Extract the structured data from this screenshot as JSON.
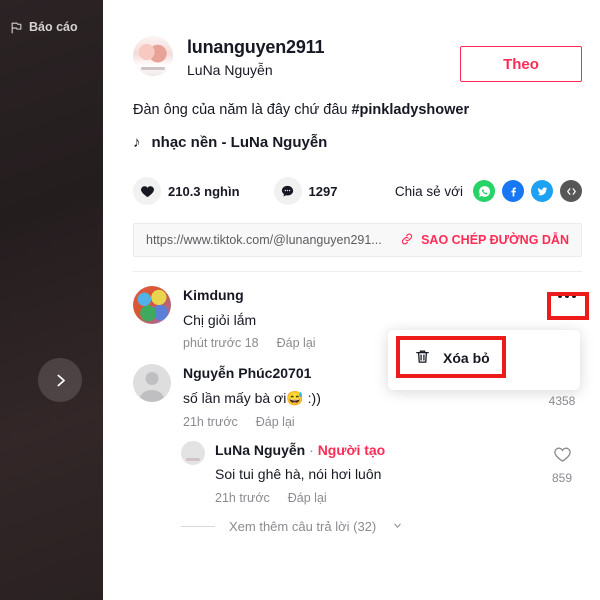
{
  "video_panel": {
    "report_label": "Báo cáo",
    "report_icon": "flag-icon",
    "next_icon": "chevron-right-icon"
  },
  "post": {
    "username": "lunanguyen2911",
    "nickname": "LuNa Nguyễn",
    "follow_label": "Theo",
    "caption_text": "Đàn ông của năm là đây chứ đâu ",
    "caption_hashtag": "#pinkladyshower",
    "music_icon": "music-note-icon",
    "music_title": "nhạc nền - LuNa Nguyễn",
    "avatar_icon": "author-avatar"
  },
  "engagement": {
    "like_icon": "heart-filled-icon",
    "like_count": "210.3 nghìn",
    "comment_icon": "comment-bubble-icon",
    "comment_count": "1297",
    "share_label": "Chia sẻ với",
    "share_targets": [
      {
        "name": "whatsapp-icon",
        "color": "#25D366"
      },
      {
        "name": "facebook-icon",
        "color": "#1877F2"
      },
      {
        "name": "twitter-icon",
        "color": "#1DA1F2"
      },
      {
        "name": "embed-code-icon",
        "color": "#575757"
      }
    ]
  },
  "link_bar": {
    "url": "https://www.tiktok.com/@lunanguyen291...",
    "placeholder": "https://www.tiktok.com/",
    "copy_icon": "link-icon",
    "copy_label_plain": "SAO CHÉP ",
    "copy_label_bold": "ĐƯỜNG DẪN"
  },
  "comments": [
    {
      "avatar": "kimdung-avatar",
      "name": "Kimdung",
      "text": "Chị giỏi lắm",
      "time": "phút trước 18",
      "reply_label": "Đáp lại",
      "has_more_menu": true
    },
    {
      "avatar": "default-avatar",
      "name": "Nguyễn Phúc20701",
      "text": "số lần mấy bà ơi😅 :))",
      "time": "21h trước",
      "reply_label": "Đáp lại",
      "like_icon": "heart-outline-icon",
      "like_count": "4358"
    },
    {
      "avatar": "luna-avatar",
      "name": "LuNa Nguyễn",
      "creator_sep": "·",
      "creator_badge": "Người tạo",
      "text": "Soi tui ghê hà, nói hơi luôn",
      "time": "21h trước",
      "reply_label": "Đáp lại",
      "like_icon": "heart-outline-icon",
      "like_count": "859",
      "is_reply": true
    }
  ],
  "view_more": {
    "label": "Xem thêm câu trả lời (32)",
    "chevron_icon": "chevron-down-icon"
  },
  "dropdown": {
    "delete_icon": "trash-icon",
    "delete_label": "Xóa bỏ"
  },
  "colors": {
    "accent": "#fe2c55",
    "annotation": "#ee1b1b",
    "text_primary": "#161823",
    "text_secondary": "#8a8b91"
  }
}
